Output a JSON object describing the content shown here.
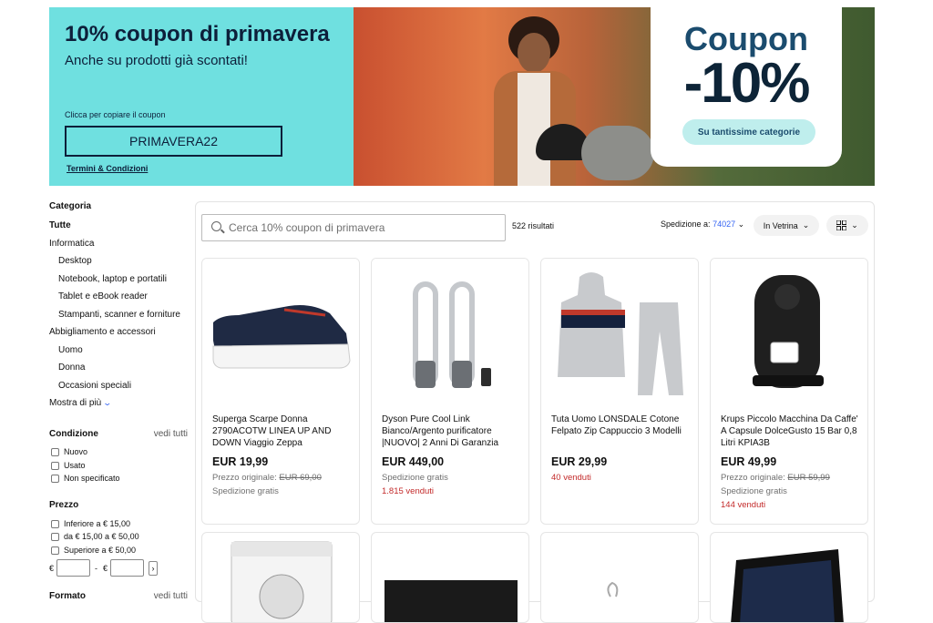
{
  "banner": {
    "title": "10% coupon di primavera",
    "subtitle": "Anche su prodotti già scontati!",
    "hint": "Clicca per copiare il coupon",
    "code": "PRIMAVERA22",
    "terms": "Termini & Condizioni",
    "card_word": "Coupon",
    "card_percent": "-10%",
    "card_pill": "Su tantissime categorie",
    "colors": {
      "left_bg": "#6fe0e0",
      "text": "#0d1f3a",
      "pill": "#bfeeed"
    }
  },
  "sidebar": {
    "category_heading": "Categoria",
    "categories": [
      {
        "label": "Tutte",
        "bold": true
      },
      {
        "label": "Informatica"
      },
      {
        "label": "Desktop",
        "sub": true
      },
      {
        "label": "Notebook, laptop e portatili",
        "sub": true
      },
      {
        "label": "Tablet e eBook reader",
        "sub": true
      },
      {
        "label": "Stampanti, scanner e forniture",
        "sub": true
      },
      {
        "label": "Abbigliamento e accessori"
      },
      {
        "label": "Uomo",
        "sub": true
      },
      {
        "label": "Donna",
        "sub": true
      },
      {
        "label": "Occasioni speciali",
        "sub": true
      }
    ],
    "show_more": "Mostra di più",
    "condition_heading": "Condizione",
    "see_all": "vedi tutti",
    "conditions": [
      "Nuovo",
      "Usato",
      "Non specificato"
    ],
    "price_heading": "Prezzo",
    "price_options": [
      "Inferiore a € 15,00",
      "da € 15,00 a € 50,00",
      "Superiore a € 50,00"
    ],
    "currency": "€",
    "dash": "-",
    "format_heading": "Formato",
    "format_see_all": "vedi tutti"
  },
  "toolbar": {
    "search_placeholder": "Cerca 10% coupon di primavera",
    "results": "522 risultati",
    "shipping_label": "Spedizione a:",
    "shipping_zip": "74027",
    "sort_label": "In Vetrina",
    "view_icon": "grid-view-icon"
  },
  "products": [
    {
      "title": "Superga Scarpe Donna 2790ACOTW LINEA UP AND DOWN Viaggio Zeppa",
      "price": "EUR 19,99",
      "original_label": "Prezzo originale:",
      "original_price": "EUR 69,00",
      "shipping": "Spedizione gratis",
      "sold": ""
    },
    {
      "title": "Dyson Pure Cool Link Bianco/Argento purificatore |NUOVO| 2 Anni Di Garanzia",
      "price": "EUR 449,00",
      "original_label": "",
      "original_price": "",
      "shipping": "Spedizione gratis",
      "sold": "1.815 venduti"
    },
    {
      "title": "Tuta Uomo LONSDALE Cotone Felpato Zip Cappuccio 3 Modelli",
      "price": "EUR 29,99",
      "original_label": "",
      "original_price": "",
      "shipping": "",
      "sold": "40 venduti"
    },
    {
      "title": "Krups Piccolo Macchina Da Caffe' A Capsule DolceGusto 15 Bar 0,8 Litri KPIA3B",
      "price": "EUR 49,99",
      "original_label": "Prezzo originale:",
      "original_price": "EUR 59,99",
      "shipping": "Spedizione gratis",
      "sold": "144 venduti"
    }
  ]
}
